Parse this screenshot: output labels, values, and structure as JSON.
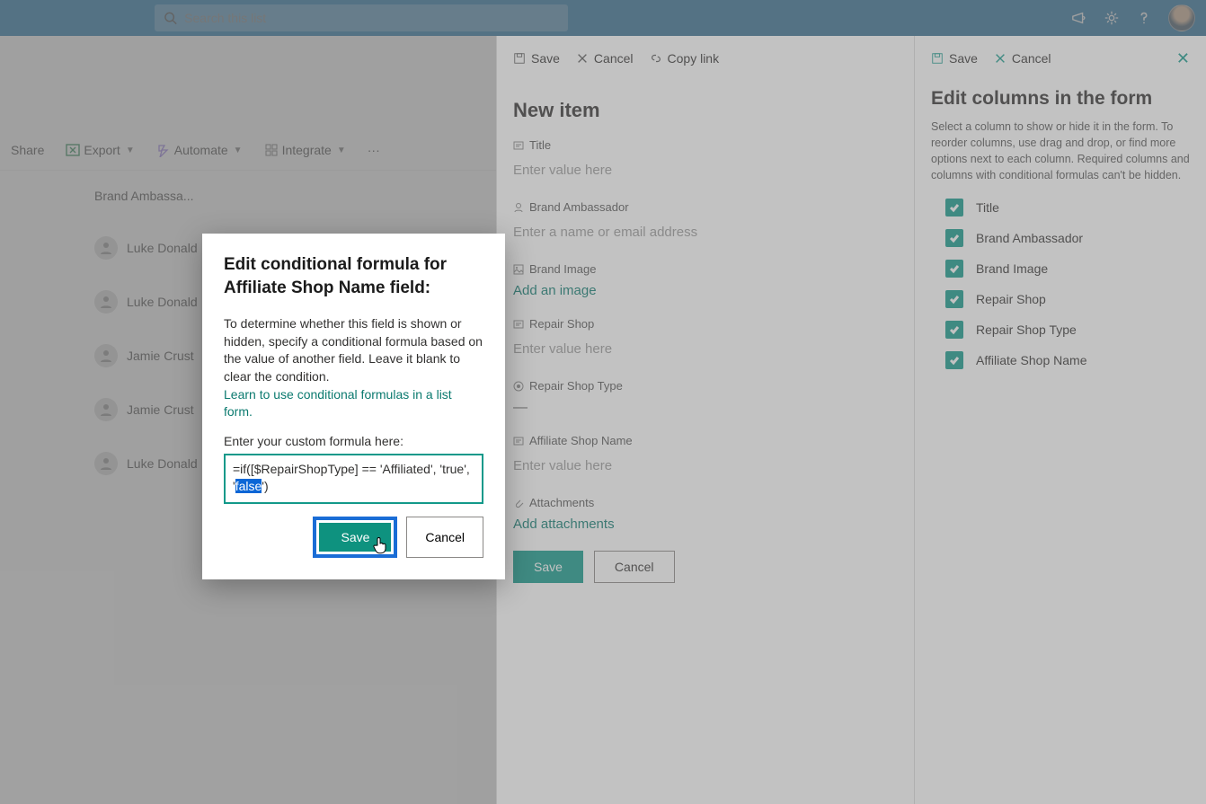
{
  "topbar": {
    "search_placeholder": "Search this list"
  },
  "cmdbar": {
    "share": "Share",
    "export": "Export",
    "automate": "Automate",
    "integrate": "Integrate"
  },
  "list": {
    "column_header": "Brand Ambassa...",
    "rows": [
      "Luke Donald",
      "Luke Donald",
      "Jamie Crust",
      "Jamie Crust",
      "Luke Donald"
    ]
  },
  "new_item": {
    "cmd_save": "Save",
    "cmd_cancel": "Cancel",
    "cmd_copy": "Copy link",
    "title": "New item",
    "fields": {
      "title": {
        "label": "Title",
        "placeholder": "Enter value here"
      },
      "brand_ambassador": {
        "label": "Brand Ambassador",
        "placeholder": "Enter a name or email address"
      },
      "brand_image": {
        "label": "Brand Image",
        "action": "Add an image"
      },
      "repair_shop": {
        "label": "Repair Shop",
        "placeholder": "Enter value here"
      },
      "repair_shop_type": {
        "label": "Repair Shop Type",
        "value": "—"
      },
      "affiliate_shop_name": {
        "label": "Affiliate Shop Name",
        "placeholder": "Enter value here"
      },
      "attachments": {
        "label": "Attachments",
        "action": "Add attachments"
      }
    },
    "btn_save": "Save",
    "btn_cancel": "Cancel"
  },
  "edit_cols": {
    "cmd_save": "Save",
    "cmd_cancel": "Cancel",
    "title": "Edit columns in the form",
    "desc": "Select a column to show or hide it in the form. To reorder columns, use drag and drop, or find more options next to each column. Required columns and columns with conditional formulas can't be hidden.",
    "items": [
      "Title",
      "Brand Ambassador",
      "Brand Image",
      "Repair Shop",
      "Repair Shop Type",
      "Affiliate Shop Name"
    ]
  },
  "modal": {
    "title": "Edit conditional formula for Affiliate Shop Name field:",
    "desc": "To determine whether this field is shown or hidden, specify a conditional formula based on the value of another field. Leave it blank to clear the condition.",
    "link": "Learn to use conditional formulas in a list form.",
    "label": "Enter your custom formula here:",
    "formula_pre": "=if([$RepairShopType] == 'Affiliated', 'true', '",
    "formula_sel": "false",
    "formula_post": "')",
    "btn_save": "Save",
    "btn_cancel": "Cancel"
  }
}
